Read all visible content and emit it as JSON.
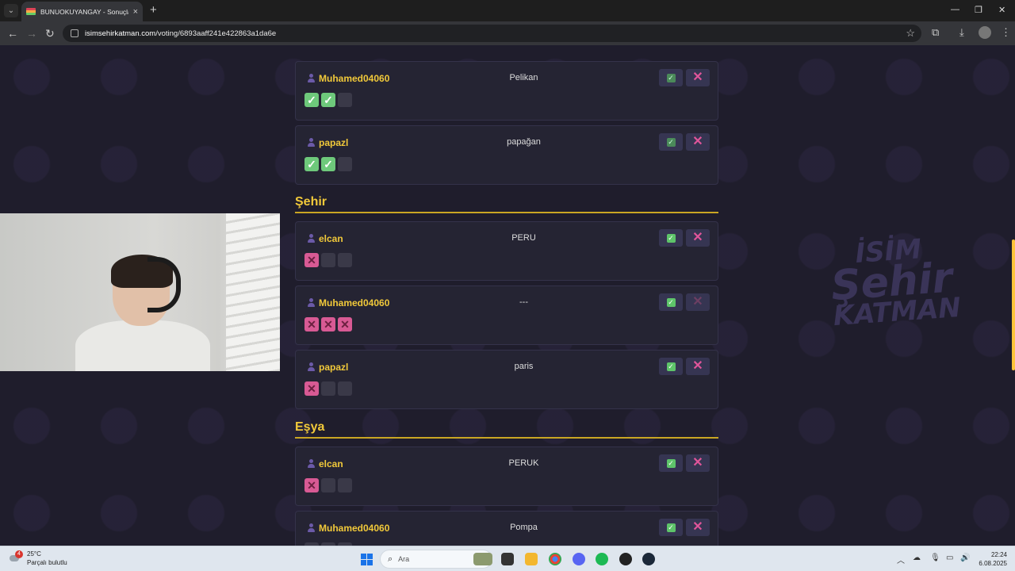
{
  "browser": {
    "tab_title": "BUNUOKUYANGAY - Sonuçlar",
    "url_domain": "isimsehirkatman.com",
    "url_path": "/voting/6893aaff241e422863a1da6e",
    "new_tab_symbol": "+",
    "tab_close_symbol": "×"
  },
  "page": {
    "logo_watermark": [
      "İSİM",
      "Şehir",
      "KATMAN"
    ],
    "sections": [
      {
        "title": "",
        "entries": [
          {
            "username": "Muhamed04060",
            "answer": "Pelikan",
            "votes": [
              "check",
              "check",
              "empty"
            ],
            "approve_dim": true,
            "reject_dim": false
          },
          {
            "username": "papazl",
            "answer": "papağan",
            "votes": [
              "check",
              "check",
              "empty"
            ],
            "approve_dim": true,
            "reject_dim": false
          }
        ]
      },
      {
        "title": "Şehir",
        "entries": [
          {
            "username": "elcan",
            "answer": "PERU",
            "votes": [
              "cross",
              "empty",
              "empty"
            ],
            "approve_dim": false,
            "reject_dim": false
          },
          {
            "username": "Muhamed04060",
            "answer": "---",
            "votes": [
              "cross",
              "cross",
              "cross"
            ],
            "approve_dim": false,
            "reject_dim": true
          },
          {
            "username": "papazl",
            "answer": "paris",
            "votes": [
              "cross",
              "empty",
              "empty"
            ],
            "approve_dim": false,
            "reject_dim": false
          }
        ]
      },
      {
        "title": "Eşya",
        "entries": [
          {
            "username": "elcan",
            "answer": "PERUK",
            "votes": [
              "cross",
              "empty",
              "empty"
            ],
            "approve_dim": false,
            "reject_dim": false
          },
          {
            "username": "Muhamed04060",
            "answer": "Pompa",
            "votes": [
              "empty",
              "empty",
              "empty"
            ],
            "approve_dim": false,
            "reject_dim": false
          }
        ]
      }
    ]
  },
  "taskbar": {
    "weather_temp": "25°C",
    "weather_desc": "Parçalı bulutlu",
    "weather_badge": "4",
    "search_placeholder": "Ara",
    "time": "22:24",
    "date": "6.08.2025"
  },
  "colors": {
    "accent_yellow": "#f1c93a",
    "approve_green": "#5ec46a",
    "reject_pink": "#e0559a",
    "page_bg": "#1f1d2c",
    "card_bg": "#252433"
  }
}
